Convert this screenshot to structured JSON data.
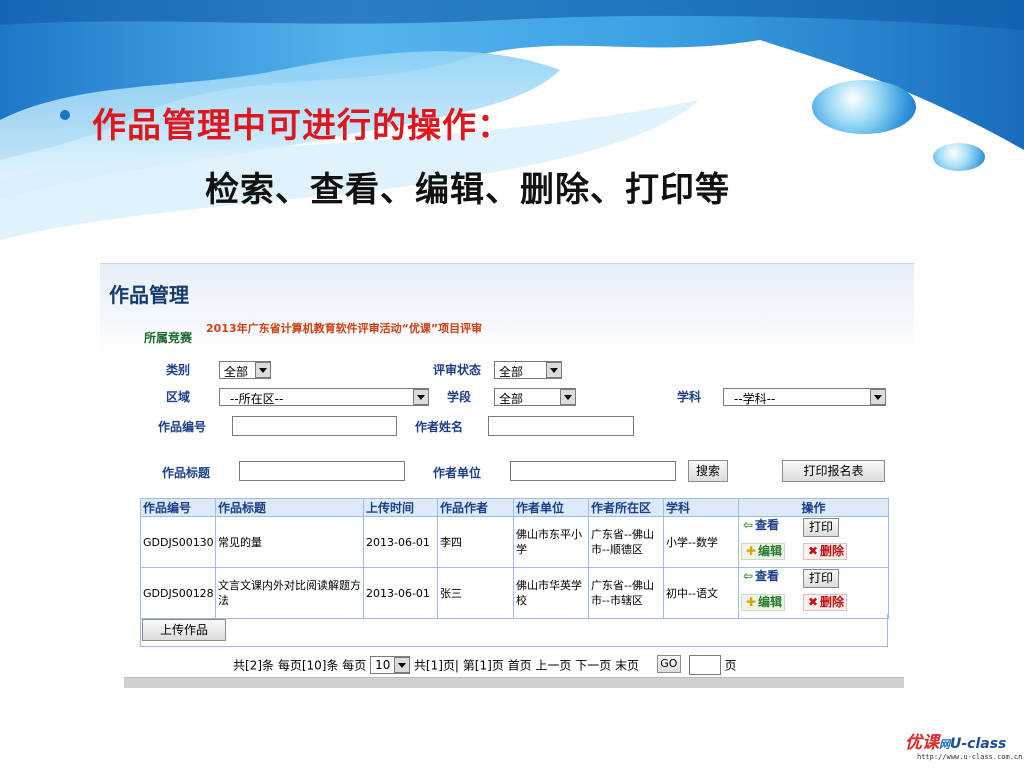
{
  "slide": {
    "title": "作品管理中可进行的操作：",
    "subtitle": "检索、查看、编辑、删除、打印等"
  },
  "panel": {
    "title": "作品管理",
    "contest": {
      "label": "所属竞赛",
      "value": "2013年广东省计算机教育软件评审活动“优课”项目评审"
    },
    "filters": {
      "category": {
        "label": "类别",
        "value": "全部"
      },
      "review_status": {
        "label": "评审状态",
        "value": "全部"
      },
      "region": {
        "label": "区域",
        "value": "--所在区--"
      },
      "stage": {
        "label": "学段",
        "value": "全部"
      },
      "subject": {
        "label": "学科",
        "value": "--学科--"
      },
      "work_id": {
        "label": "作品编号",
        "value": ""
      },
      "author_name": {
        "label": "作者姓名",
        "value": ""
      },
      "work_title": {
        "label": "作品标题",
        "value": ""
      },
      "author_unit": {
        "label": "作者单位",
        "value": ""
      }
    },
    "buttons": {
      "search": "搜索",
      "print_list": "打印报名表",
      "upload": "上传作品"
    },
    "table": {
      "columns": [
        "作品编号",
        "作品标题",
        "上传时间",
        "作品作者",
        "作者单位",
        "作者所在区",
        "学科",
        "操作"
      ],
      "rows": [
        {
          "id": "GDDJS00130",
          "title": "常见的量",
          "time": "2013-06-01",
          "author": "李四",
          "unit": "佛山市东平小学",
          "district": "广东省--佛山市--顺德区",
          "subject": "小学--数学"
        },
        {
          "id": "GDDJS00128",
          "title": "文言文课内外对比阅读解题方法",
          "time": "2013-06-01",
          "author": "张三",
          "unit": "佛山市华英学校",
          "district": "广东省--佛山市--市辖区",
          "subject": "初中--语文"
        }
      ],
      "actions": {
        "view": "查看",
        "print": "打印",
        "edit": "编辑",
        "delete": "删除"
      }
    },
    "pager": {
      "summary": "共[2]条  每页[10]条  每页",
      "per_page": "10",
      "pages": "共[1]页| 第[1]页   首页  上一页  下一页  末页",
      "go": "GO",
      "page_value": "",
      "page_suffix": "页"
    }
  },
  "footer": {
    "logo_cn": "优课",
    "logo_mid": "网",
    "logo_en": "U-class",
    "url": "http://www.u-class.com.cn"
  },
  "colors": {
    "title_red": "#e0161e",
    "header_blue": "#1d3f8a",
    "water_blue": "#2a8fd8"
  }
}
